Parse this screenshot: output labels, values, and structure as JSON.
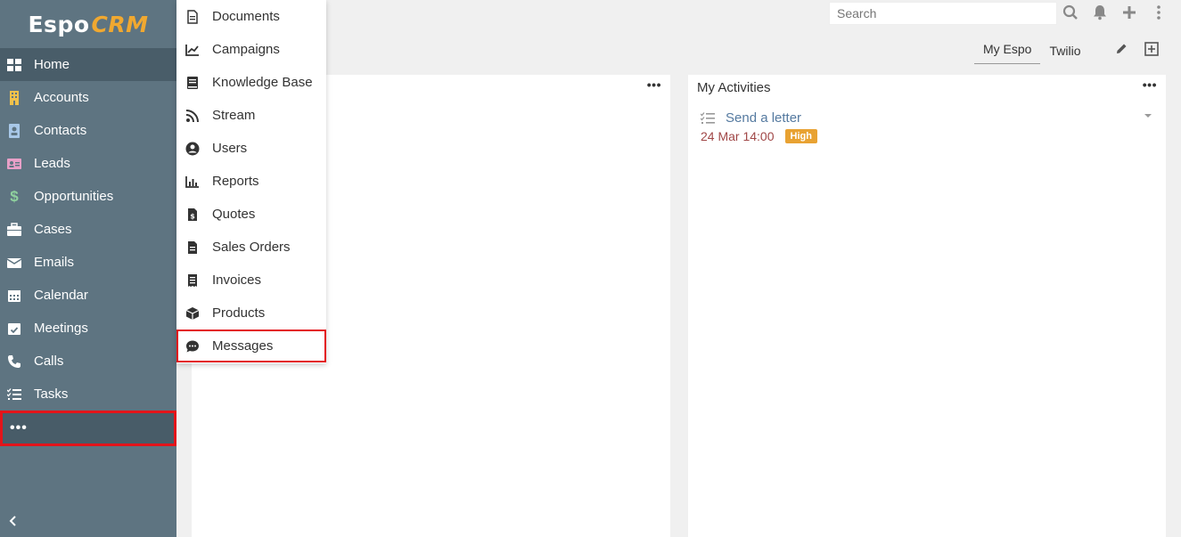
{
  "app": {
    "logo_main": "Espo",
    "logo_accent": "CRM"
  },
  "sidebar": {
    "items": [
      {
        "label": "Home",
        "icon": "home-grid-icon",
        "color": "#ffffff"
      },
      {
        "label": "Accounts",
        "icon": "building-icon",
        "color": "#f0c14b"
      },
      {
        "label": "Contacts",
        "icon": "contact-card-icon",
        "color": "#a8c8e8"
      },
      {
        "label": "Leads",
        "icon": "id-card-icon",
        "color": "#e8a0c8"
      },
      {
        "label": "Opportunities",
        "icon": "dollar-icon",
        "color": "#8fd19e"
      },
      {
        "label": "Cases",
        "icon": "briefcase-icon",
        "color": "#ffffff"
      },
      {
        "label": "Emails",
        "icon": "envelope-icon",
        "color": "#ffffff"
      },
      {
        "label": "Calendar",
        "icon": "calendar-icon",
        "color": "#ffffff"
      },
      {
        "label": "Meetings",
        "icon": "calendar-check-icon",
        "color": "#ffffff"
      },
      {
        "label": "Calls",
        "icon": "phone-icon",
        "color": "#ffffff"
      },
      {
        "label": "Tasks",
        "icon": "tasks-icon",
        "color": "#ffffff"
      }
    ],
    "more_label": "•••"
  },
  "search": {
    "placeholder": "Search"
  },
  "dashboard_tabs": [
    {
      "label": "My Espo",
      "active": true
    },
    {
      "label": "Twilio",
      "active": false
    }
  ],
  "dropdown": {
    "items": [
      {
        "label": "Documents",
        "icon": "file-icon"
      },
      {
        "label": "Campaigns",
        "icon": "chart-line-icon"
      },
      {
        "label": "Knowledge Base",
        "icon": "book-icon"
      },
      {
        "label": "Stream",
        "icon": "rss-icon"
      },
      {
        "label": "Users",
        "icon": "user-circle-icon"
      },
      {
        "label": "Reports",
        "icon": "bar-chart-icon"
      },
      {
        "label": "Quotes",
        "icon": "file-invoice-dollar-icon"
      },
      {
        "label": "Sales Orders",
        "icon": "file-alt-icon"
      },
      {
        "label": "Invoices",
        "icon": "receipt-icon"
      },
      {
        "label": "Products",
        "icon": "cube-icon"
      },
      {
        "label": "Messages",
        "icon": "sms-icon"
      }
    ]
  },
  "panels": {
    "left": {
      "menu": "•••"
    },
    "right": {
      "title": "My Activities",
      "menu": "•••",
      "activity": {
        "name": "Send a letter",
        "date": "24 Mar 14:00",
        "priority": "High"
      }
    }
  },
  "colors": {
    "sidebar": "#5e7481",
    "highlight": "#e3141a",
    "badge": "#e8a232"
  }
}
